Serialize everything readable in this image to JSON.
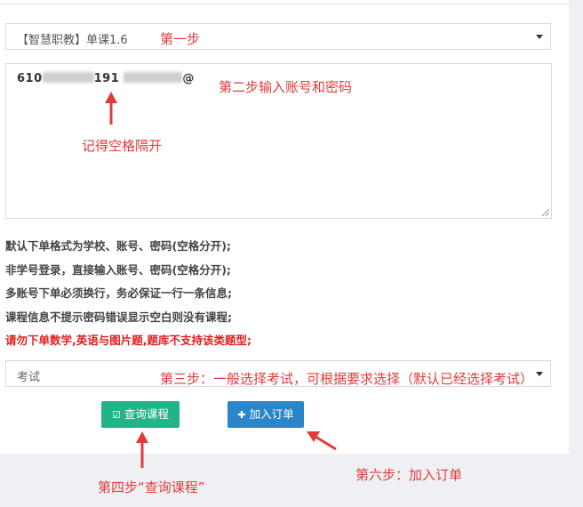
{
  "course_select": {
    "value": "【智慧职教】单课1.6"
  },
  "account_input": {
    "value_prefix": "610",
    "value_mid": "191",
    "value_suffix": "@"
  },
  "instructions": [
    "默认下单格式为学校、账号、密码(空格分开);",
    "非学号登录，直接输入账号、密码(空格分开);",
    "多账号下单必须换行，务必保证一行一条信息;",
    "课程信息不提示密码错误显示空白则没有课程;"
  ],
  "warning": "请勿下单数学,英语与图片题,题库不支持该类题型;",
  "exam_select": {
    "value": "考试"
  },
  "buttons": {
    "query_label": "查询课程",
    "add_label": "加入订单"
  },
  "annotations": {
    "step1": "第一步",
    "step2": "第二步输入账号和密码",
    "space_hint": "记得空格隔开",
    "step3": "第三步：一般选择考试，可根据要求选择（默认已经选择考试）",
    "step4": "第四步“查询课程”",
    "step6": "第六步：加入订单"
  },
  "colors": {
    "annotation": "#e23b3b",
    "query_button": "#1fb48a",
    "add_button": "#2a86c9",
    "warning": "#e02020"
  }
}
